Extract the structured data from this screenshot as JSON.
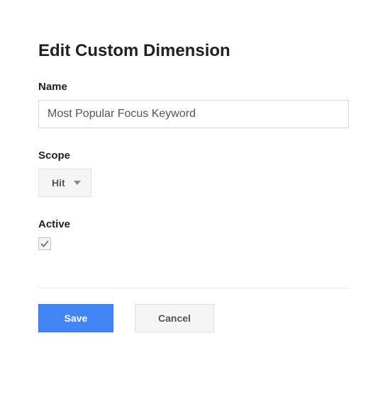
{
  "title": "Edit Custom Dimension",
  "fields": {
    "name": {
      "label": "Name",
      "value": "Most Popular Focus Keyword"
    },
    "scope": {
      "label": "Scope",
      "value": "Hit"
    },
    "active": {
      "label": "Active",
      "checked": true
    }
  },
  "actions": {
    "save": "Save",
    "cancel": "Cancel"
  }
}
